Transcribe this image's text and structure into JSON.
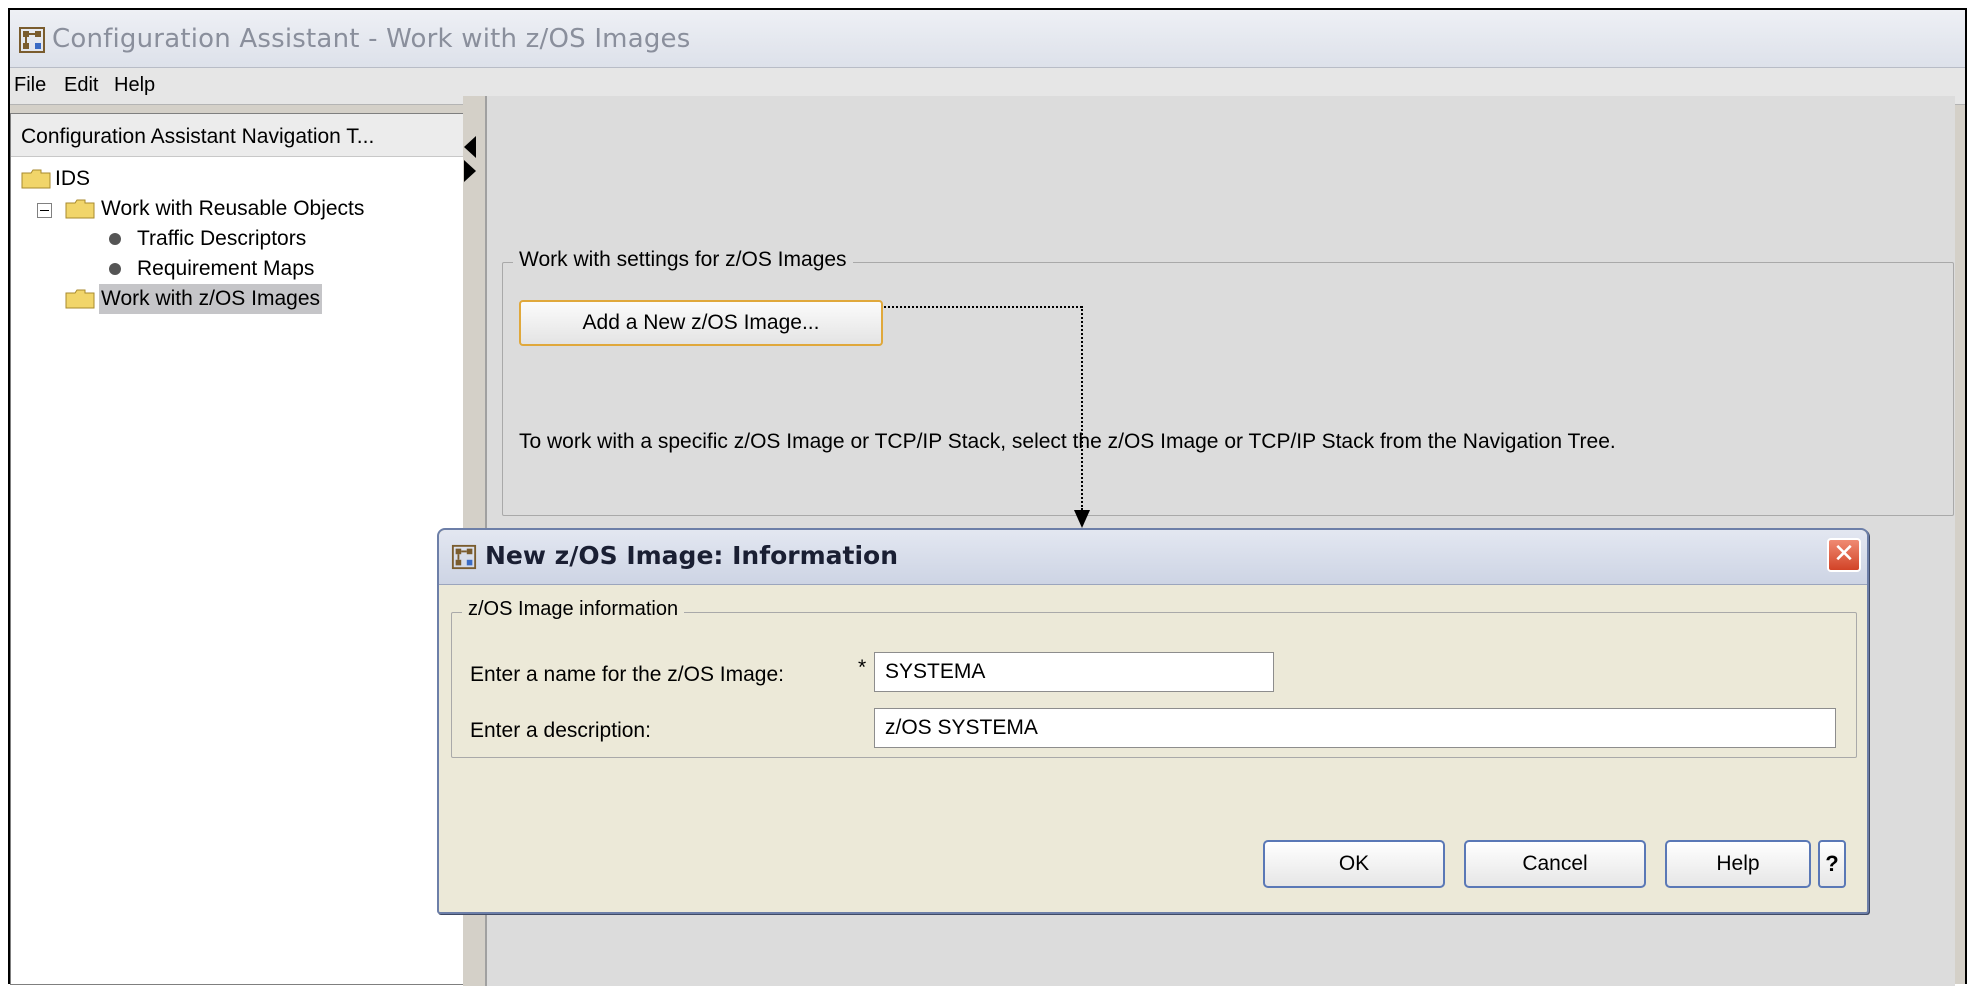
{
  "window": {
    "title": "Configuration Assistant - Work with z/OS Images"
  },
  "menu": {
    "items": [
      "File",
      "Edit",
      "Help"
    ]
  },
  "nav": {
    "header": "Configuration Assistant Navigation T...",
    "tree": [
      {
        "label": "IDS",
        "icon": "folder-icon"
      },
      {
        "label": "Work with Reusable Objects",
        "icon": "folder-icon",
        "expanded": true
      },
      {
        "label": "Traffic Descriptors",
        "icon": "bullet-icon"
      },
      {
        "label": "Requirement Maps",
        "icon": "bullet-icon"
      },
      {
        "label": "Work with z/OS Images",
        "icon": "folder-icon",
        "selected": true
      }
    ]
  },
  "main": {
    "group_title": "Work with settings for z/OS Images",
    "add_button": "Add a New z/OS Image...",
    "hint": "To work with a specific z/OS Image or TCP/IP Stack, select the z/OS Image or TCP/IP Stack from the Navigation Tree."
  },
  "dialog": {
    "title": "New z/OS Image: Information",
    "group_title": "z/OS Image information",
    "name_label": "Enter a name for the z/OS Image:",
    "required_mark": "*",
    "name_value": "SYSTEMA",
    "desc_label": "Enter a description:",
    "desc_value": "z/OS SYSTEMA",
    "ok": "OK",
    "cancel": "Cancel",
    "help": "Help",
    "context_help": "?",
    "close": "✕"
  },
  "colors": {
    "focus_border": "#e0a83b",
    "close_button": "#d24327",
    "button_border": "#5a78b6"
  }
}
